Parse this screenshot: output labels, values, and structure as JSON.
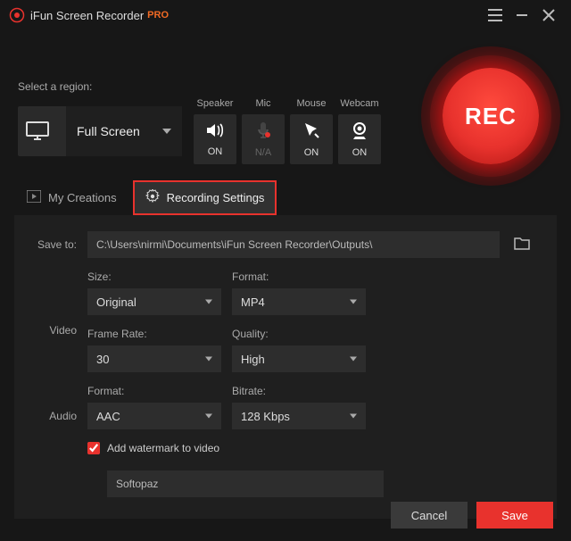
{
  "title": "iFun Screen Recorder",
  "badge": "PRO",
  "region": {
    "label": "Select a region:",
    "value": "Full Screen"
  },
  "sources": {
    "speaker": {
      "label": "Speaker",
      "state": "ON"
    },
    "mic": {
      "label": "Mic",
      "state": "N/A"
    },
    "mouse": {
      "label": "Mouse",
      "state": "ON"
    },
    "webcam": {
      "label": "Webcam",
      "state": "ON"
    }
  },
  "rec_label": "REC",
  "tabs": {
    "my_creations": "My Creations",
    "recording_settings": "Recording Settings"
  },
  "settings": {
    "save_to_label": "Save to:",
    "save_to_path": "C:\\Users\\nirmi\\Documents\\iFun Screen Recorder\\Outputs\\",
    "video_label": "Video",
    "audio_label": "Audio",
    "size_label": "Size:",
    "size_value": "Original",
    "format_label": "Format:",
    "video_format_value": "MP4",
    "framerate_label": "Frame Rate:",
    "framerate_value": "30",
    "quality_label": "Quality:",
    "quality_value": "High",
    "audio_format_value": "AAC",
    "bitrate_label": "Bitrate:",
    "bitrate_value": "128 Kbps",
    "watermark_label": "Add watermark to video",
    "watermark_checked": true,
    "watermark_text": "Softopaz"
  },
  "buttons": {
    "cancel": "Cancel",
    "save": "Save"
  }
}
